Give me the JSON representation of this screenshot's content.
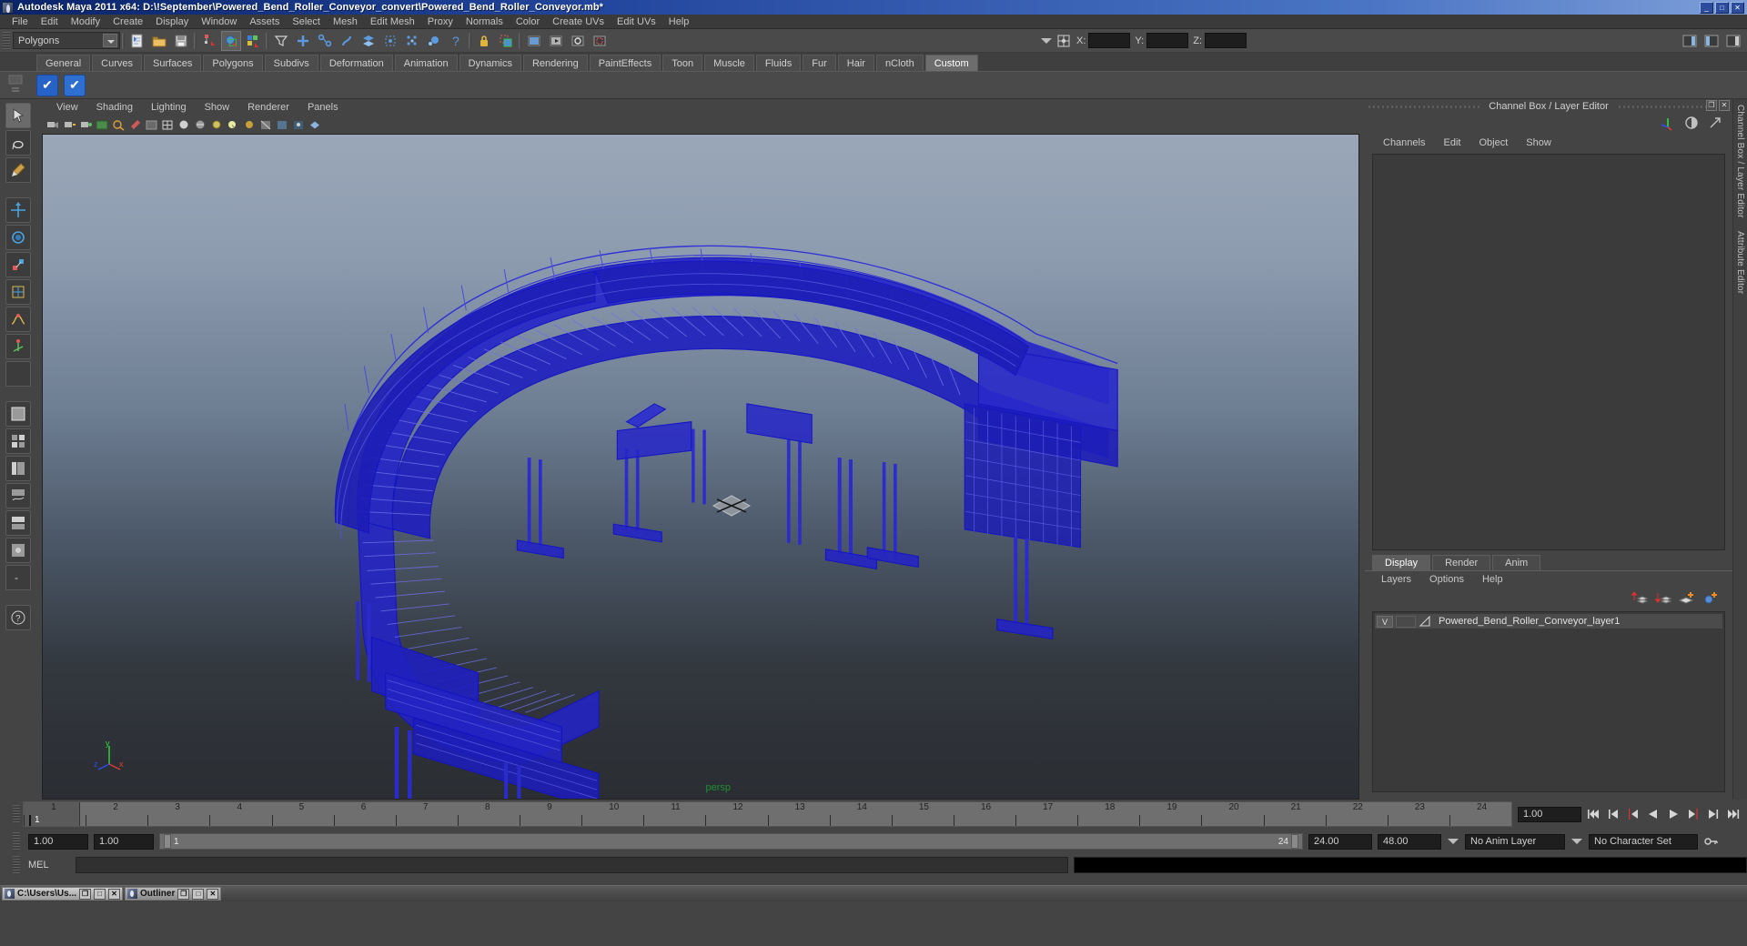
{
  "window": {
    "title": "Autodesk Maya 2011 x64: D:\\!September\\Powered_Bend_Roller_Conveyor_convert\\Powered_Bend_Roller_Conveyor.mb*",
    "minimize_label": "_",
    "maximize_label": "□",
    "close_label": "✕",
    "titlebar_color": "#23479e"
  },
  "menubar": {
    "items": [
      {
        "label": "File"
      },
      {
        "label": "Edit"
      },
      {
        "label": "Modify"
      },
      {
        "label": "Create"
      },
      {
        "label": "Display"
      },
      {
        "label": "Window"
      },
      {
        "label": "Assets"
      },
      {
        "label": "Select"
      },
      {
        "label": "Mesh"
      },
      {
        "label": "Edit Mesh"
      },
      {
        "label": "Proxy"
      },
      {
        "label": "Normals"
      },
      {
        "label": "Color"
      },
      {
        "label": "Create UVs"
      },
      {
        "label": "Edit UVs"
      },
      {
        "label": "Help"
      }
    ]
  },
  "statusline": {
    "mode_selector": {
      "value": "Polygons"
    },
    "coords": {
      "x_label": "X:",
      "y_label": "Y:",
      "z_label": "Z:",
      "x_value": "",
      "y_value": "",
      "z_value": ""
    },
    "icons": [
      "new-scene-icon",
      "open-scene-icon",
      "save-scene-icon",
      "select-by-hierarchy-icon",
      "select-by-object-icon",
      "select-by-component-icon",
      "filter-icon",
      "snap-grid-icon",
      "snap-curve-icon",
      "snap-point-icon",
      "snap-view-plane-icon",
      "snap-to-live-icon",
      "construction-history-icon",
      "make-live-icon",
      "help-icon",
      "lock-icon",
      "highlight-selection-icon",
      "render-current-frame-icon",
      "ipr-render-icon",
      "render-settings-icon",
      "show-hide-channel-box-icon",
      "show-hide-attribute-editor-icon",
      "show-hide-tool-settings-icon"
    ]
  },
  "shelf": {
    "tabs": [
      {
        "label": "General"
      },
      {
        "label": "Curves"
      },
      {
        "label": "Surfaces"
      },
      {
        "label": "Polygons"
      },
      {
        "label": "Subdivs"
      },
      {
        "label": "Deformation"
      },
      {
        "label": "Animation"
      },
      {
        "label": "Dynamics"
      },
      {
        "label": "Rendering"
      },
      {
        "label": "PaintEffects"
      },
      {
        "label": "Toon"
      },
      {
        "label": "Muscle"
      },
      {
        "label": "Fluids"
      },
      {
        "label": "Fur"
      },
      {
        "label": "Hair"
      },
      {
        "label": "nCloth"
      },
      {
        "label": "Custom"
      }
    ],
    "active_tab": "Custom",
    "buttons": [
      {
        "name": "custom-shelf-button-1",
        "glyph": "✔"
      },
      {
        "name": "custom-shelf-button-2",
        "glyph": "✔"
      }
    ]
  },
  "toolbox": {
    "items": [
      {
        "name": "select-tool",
        "icon": "arrow-cursor-icon"
      },
      {
        "name": "lasso-tool",
        "icon": "lasso-icon"
      },
      {
        "name": "paint-select-tool",
        "icon": "paint-brush-icon"
      },
      {
        "name": "move-tool",
        "icon": "move-arrows-icon"
      },
      {
        "name": "rotate-tool",
        "icon": "rotate-circle-icon"
      },
      {
        "name": "scale-tool",
        "icon": "scale-box-icon"
      },
      {
        "name": "universal-manipulator-tool",
        "icon": "universal-manip-icon"
      },
      {
        "name": "soft-modification-tool",
        "icon": "soft-mod-icon"
      },
      {
        "name": "show-manipulator-tool",
        "icon": "show-manip-icon"
      },
      {
        "name": "last-tool-used",
        "icon": "blank-icon"
      },
      {
        "name": "layout-single-perspective",
        "icon": "layout-single-icon"
      },
      {
        "name": "layout-four-view",
        "icon": "layout-four-icon"
      },
      {
        "name": "layout-persp-outliner",
        "icon": "layout-persp-outliner-icon"
      },
      {
        "name": "layout-persp-graph",
        "icon": "layout-graph-icon"
      },
      {
        "name": "layout-hypershade-persp",
        "icon": "layout-hypershade-icon"
      },
      {
        "name": "layout-persp-render",
        "icon": "layout-render-icon"
      },
      {
        "name": "layout-more",
        "icon": "layout-more-icon"
      },
      {
        "name": "help-quick-rig",
        "icon": "question-help-icon"
      }
    ]
  },
  "viewport": {
    "menus": [
      {
        "label": "View"
      },
      {
        "label": "Shading"
      },
      {
        "label": "Lighting"
      },
      {
        "label": "Show"
      },
      {
        "label": "Renderer"
      },
      {
        "label": "Panels"
      }
    ],
    "camera_label": "persp",
    "axis": {
      "x": "x",
      "y": "y",
      "z": "z",
      "x_color": "#e23b2e",
      "y_color": "#2fd83f",
      "z_color": "#2b4ff0"
    },
    "toolbar_icons": [
      "select-camera-icon",
      "lock-camera-icon",
      "camera-attributes-icon",
      "image-plane-icon",
      "two-d-pan-zoom-icon",
      "grease-pencil-icon",
      "exposure-icon",
      "gamma-icon",
      "wireframe-shading-icon",
      "smooth-shade-all-icon",
      "smooth-shade-textured-icon",
      "use-all-lights-icon",
      "shadows-icon",
      "screen-space-ao-icon",
      "motion-blur-icon",
      "multisample-icon",
      "depth-of-field-icon",
      "xray-icon",
      "xray-joints-icon",
      "isolate-select-icon"
    ],
    "model_color": "#1a1ac8",
    "background_top": "#9aa7b8",
    "background_bottom": "#2a2d32"
  },
  "channel_box": {
    "panel_title": "Channel Box / Layer Editor",
    "menus": [
      {
        "label": "Channels"
      },
      {
        "label": "Edit"
      },
      {
        "label": "Object"
      },
      {
        "label": "Show"
      }
    ],
    "maximize_label": "❐",
    "close_label": "✕",
    "contents": ""
  },
  "layer_editor": {
    "tabs": [
      {
        "label": "Display"
      },
      {
        "label": "Render"
      },
      {
        "label": "Anim"
      }
    ],
    "active_tab": "Display",
    "menus": [
      {
        "label": "Layers"
      },
      {
        "label": "Options"
      },
      {
        "label": "Help"
      }
    ],
    "buttons": [
      {
        "name": "move-layer-up-button",
        "icon": "layer-up-icon"
      },
      {
        "name": "move-layer-down-button",
        "icon": "layer-down-icon"
      },
      {
        "name": "new-layer-button",
        "icon": "new-layer-icon"
      },
      {
        "name": "new-layer-from-selected-button",
        "icon": "new-layer-selected-icon"
      }
    ],
    "layers": [
      {
        "visibility": "V",
        "playback": "",
        "name": "Powered_Bend_Roller_Conveyor_layer1"
      }
    ]
  },
  "right_vertical_tabs": [
    {
      "label": "Channel Box / Layer Editor"
    },
    {
      "label": "Attribute Editor"
    }
  ],
  "timeline": {
    "ticks": [
      "1",
      "2",
      "3",
      "4",
      "5",
      "6",
      "7",
      "8",
      "9",
      "10",
      "11",
      "12",
      "13",
      "14",
      "15",
      "16",
      "17",
      "18",
      "19",
      "20",
      "21",
      "22",
      "23",
      "24"
    ],
    "current_frame": "1",
    "current_frame_field": "1.00",
    "playback_buttons": [
      {
        "name": "go-to-start-button",
        "icon": "skip-start-icon"
      },
      {
        "name": "step-back-frame-button",
        "icon": "step-back-icon"
      },
      {
        "name": "step-back-key-button",
        "icon": "step-back-key-icon"
      },
      {
        "name": "play-backwards-button",
        "icon": "play-backward-icon"
      },
      {
        "name": "play-forwards-button",
        "icon": "play-forward-icon"
      },
      {
        "name": "step-forward-key-button",
        "icon": "step-forward-key-icon"
      },
      {
        "name": "step-forward-frame-button",
        "icon": "step-forward-icon"
      },
      {
        "name": "go-to-end-button",
        "icon": "skip-end-icon"
      }
    ]
  },
  "range_slider": {
    "start_field": "1.00",
    "end_field": "1.00",
    "range_start": "1",
    "range_end": "24",
    "playback_start": "24.00",
    "playback_end": "48.00",
    "anim_layer": "No Anim Layer",
    "character_set": "No Character Set",
    "key_icon": "key-icon"
  },
  "command_line": {
    "language_label": "MEL",
    "input_value": "",
    "result_value": ""
  },
  "taskbar": {
    "items": [
      {
        "label": "C:\\Users\\Us...",
        "restore": "❐",
        "maximize": "□",
        "close": "✕"
      },
      {
        "label": "Outliner",
        "restore": "❐",
        "maximize": "□",
        "close": "✕"
      }
    ]
  }
}
